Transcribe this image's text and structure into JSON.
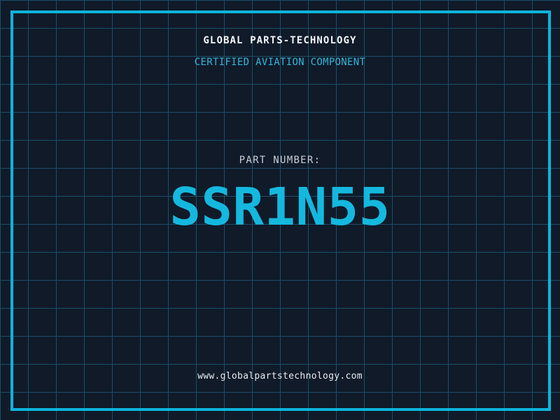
{
  "header": {
    "title": "GLOBAL PARTS-TECHNOLOGY",
    "subtitle": "CERTIFIED AVIATION COMPONENT"
  },
  "main": {
    "part_label": "PART NUMBER:",
    "part_number": "SSR1N55"
  },
  "footer": {
    "url": "www.globalpartstechnology.com"
  },
  "colors": {
    "background": "#101a29",
    "grid_line": "#1c5068",
    "frame_border": "#0cb5dc",
    "title_text": "#f4f7f9",
    "subtitle_text": "#2eb8da",
    "label_text": "#c9cfd9",
    "part_number_text": "#14b8de",
    "url_text": "#e9edf0"
  }
}
